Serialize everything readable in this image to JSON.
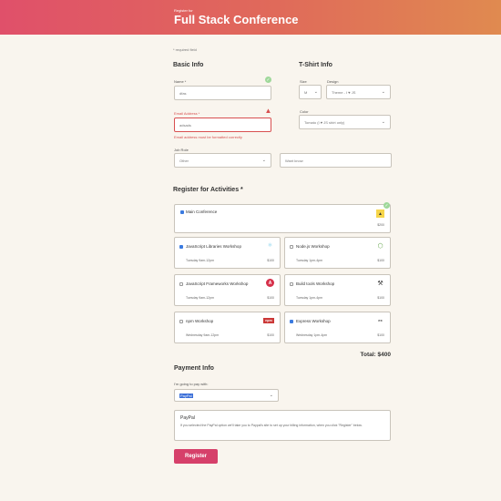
{
  "header": {
    "subtitle": "Register for",
    "title": "Full Stack Conference"
  },
  "required_note": "* required field",
  "basic": {
    "heading": "Basic Info",
    "name_label": "Name *",
    "name_value": "dfas",
    "email_label": "Email Address *",
    "email_value": "adsads",
    "email_error": "Email address must be formatted correctly",
    "job_label": "Job Role",
    "job_value": "Other",
    "other_placeholder": "Want know"
  },
  "tshirt": {
    "heading": "T-Shirt Info",
    "size_label": "Size",
    "size_value": "M",
    "design_label": "Design",
    "design_value": "Theme - I ♥ JS",
    "color_label": "Color",
    "color_value": "Tomato (I ♥ JS shirt only)"
  },
  "activities": {
    "heading": "Register for Activities *",
    "main": {
      "name": "Main Conference",
      "price": "$200",
      "checked": true,
      "icon": "conference-icon"
    },
    "items": [
      {
        "name": "JavaScript Libraries Workshop",
        "when": "Tuesday 9am-12pm",
        "price": "$100",
        "checked": true,
        "icon": "react-icon"
      },
      {
        "name": "Node.js Workshop",
        "when": "Tuesday 1pm-4pm",
        "price": "$100",
        "checked": false,
        "icon": "nodejs-icon"
      },
      {
        "name": "JavaScript Frameworks Workshop",
        "when": "Tuesday 9am-12pm",
        "price": "$100",
        "checked": false,
        "icon": "angular-icon"
      },
      {
        "name": "Build tools Workshop",
        "when": "Tuesday 1pm-4pm",
        "price": "$100",
        "checked": false,
        "icon": "tools-icon"
      },
      {
        "name": "npm Workshop",
        "when": "Wednesday 9am-12pm",
        "price": "$100",
        "checked": false,
        "icon": "npm-icon"
      },
      {
        "name": "Express Workshop",
        "when": "Wednesday 1pm-4pm",
        "price": "$100",
        "checked": true,
        "icon": "express-icon"
      }
    ],
    "total": "Total: $400"
  },
  "payment": {
    "heading": "Payment Info",
    "label": "I'm going to pay with:",
    "method": "PayPal",
    "box_title": "PayPal",
    "box_text": "If you selected the PayPal option we'll take you to Paypal's site to set up your billing information, when you click \"Register\" below."
  },
  "register_label": "Register",
  "colors": {
    "accent": "#d6406a",
    "error": "#d85050",
    "check": "#3b7be0",
    "valid": "#6cc070"
  }
}
